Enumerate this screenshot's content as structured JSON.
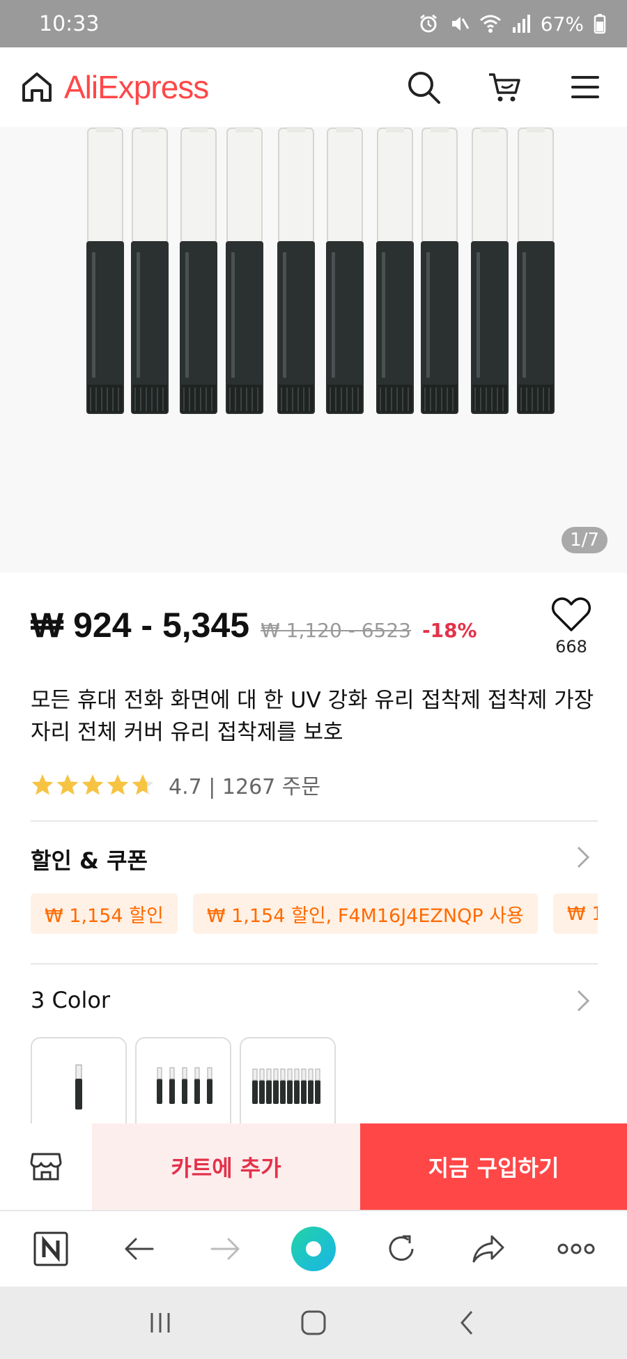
{
  "status_bar": {
    "time": "10:33",
    "battery": "67%"
  },
  "header": {
    "brand": "AliExpress",
    "icons": [
      "home-icon",
      "search-icon",
      "cart-icon",
      "menu-icon"
    ]
  },
  "product_image": {
    "counter": "1/7"
  },
  "price": {
    "current": "₩ 924 - 5,345",
    "original": "₩ 1,120 - 6523",
    "discount": "-18%"
  },
  "wishlist": {
    "count": "668"
  },
  "title": "모든 휴대 전화 화면에 대 한 UV 강화 유리 접착제 접착제 가장자리 전체 커버 유리 접착제를 보호",
  "rating": {
    "value": 4.7,
    "text": "4.7 | 1267 주문"
  },
  "discounts": {
    "title": "할인 & 쿠폰",
    "coupons": [
      "₩ 1,154 할인",
      "₩ 1,154 할인, F4M16J4EZNQP 사용",
      "₩ 1,"
    ]
  },
  "colors": {
    "title": "3 Color",
    "swatches": [
      "1 pen",
      "5 pens",
      "10 pens"
    ]
  },
  "actions": {
    "add_to_cart": "카트에 추가",
    "buy_now": "지금 구입하기"
  },
  "browser_toolbar": {
    "icons": [
      "naver-icon",
      "back-arrow-icon",
      "forward-arrow-icon",
      "green-dot-icon",
      "refresh-icon",
      "share-icon",
      "more-icon"
    ]
  },
  "system_nav": {
    "icons": [
      "recent-apps-icon",
      "home-button-icon",
      "back-button-icon"
    ]
  },
  "colors_theme": {
    "brand_red": "#ff4747",
    "discount_red": "#e3324a",
    "coupon_orange": "#ff6a00",
    "coupon_bg": "#fff1e5",
    "star_yellow": "#f6c343"
  }
}
